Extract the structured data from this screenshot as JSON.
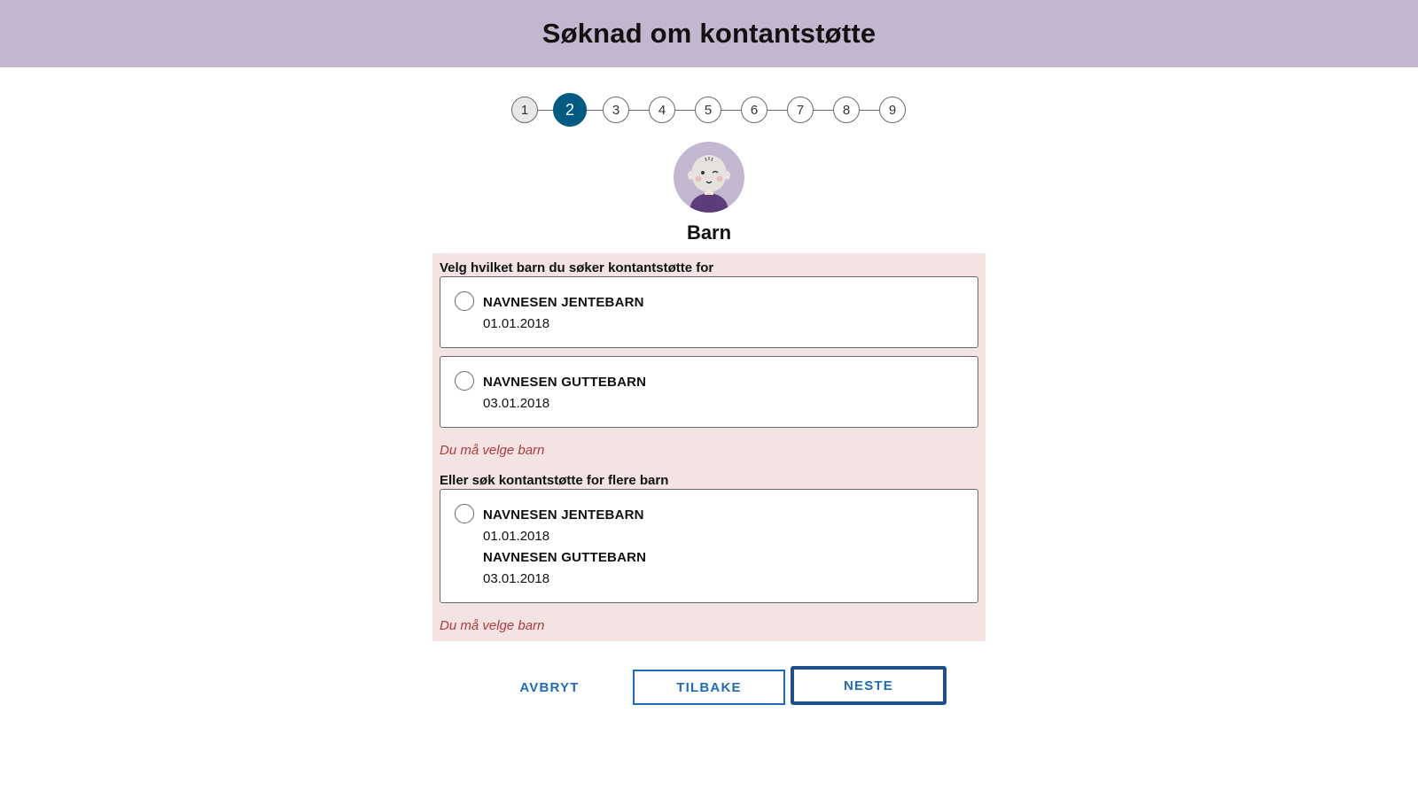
{
  "header": {
    "title": "Søknad om kontantstøtte"
  },
  "stepper": {
    "steps": [
      "1",
      "2",
      "3",
      "4",
      "5",
      "6",
      "7",
      "8",
      "9"
    ],
    "current_step": 2
  },
  "section": {
    "title": "Barn",
    "icon": "baby-avatar-icon"
  },
  "single_choice": {
    "label": "Velg hvilket barn du søker kontantstøtte for",
    "options": [
      {
        "name": "NAVNESEN JENTEBARN",
        "date": "01.01.2018"
      },
      {
        "name": "NAVNESEN GUTTEBARN",
        "date": "03.01.2018"
      }
    ],
    "error": "Du må velge barn"
  },
  "multi_choice": {
    "label": "Eller søk kontantstøtte for flere barn",
    "children": [
      {
        "name": "NAVNESEN JENTEBARN",
        "date": "01.01.2018"
      },
      {
        "name": "NAVNESEN GUTTEBARN",
        "date": "03.01.2018"
      }
    ],
    "error": "Du må velge barn"
  },
  "buttons": {
    "cancel": "AVBRYT",
    "back": "TILBAKE",
    "next": "NESTE"
  },
  "colors": {
    "header_bg": "#c3b7d0",
    "active_step": "#005b82",
    "error_panel": "#f3e3e3",
    "error_text": "#b33a3a",
    "link_blue": "#1f6bbf"
  }
}
